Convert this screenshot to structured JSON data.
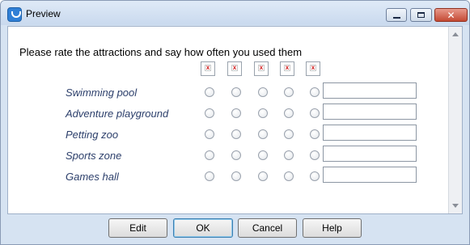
{
  "window": {
    "title": "Preview"
  },
  "survey": {
    "question": "Please rate the attractions and say how often you used them",
    "rating_columns": 5,
    "rows": [
      {
        "label": "Swimming pool",
        "text_value": ""
      },
      {
        "label": "Adventure playground",
        "text_value": ""
      },
      {
        "label": "Petting zoo",
        "text_value": ""
      },
      {
        "label": "Sports zone",
        "text_value": ""
      },
      {
        "label": "Games hall",
        "text_value": ""
      }
    ]
  },
  "buttons": {
    "edit": "Edit",
    "ok": "OK",
    "cancel": "Cancel",
    "help": "Help"
  },
  "icons": {
    "column_header": "broken-image-icon",
    "app": "preview-app-icon"
  }
}
